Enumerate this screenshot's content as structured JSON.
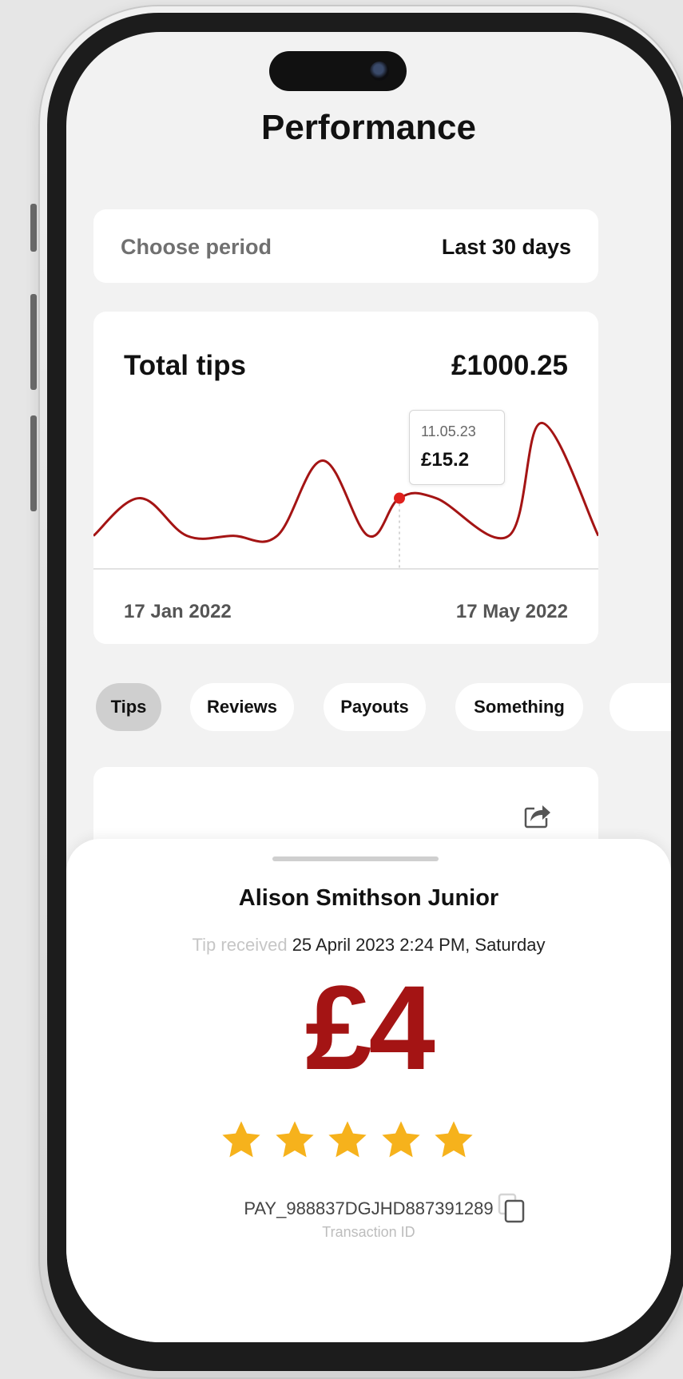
{
  "header": {
    "title": "Performance"
  },
  "period": {
    "label": "Choose period",
    "value": "Last 30 days"
  },
  "chart_data": {
    "type": "line",
    "title": "Total tips",
    "total": "£1000.25",
    "x_start_label": "17 Jan 2022",
    "x_end_label": "17 May 2022",
    "series_color": "#a41414",
    "highlight_color": "#e0201c",
    "y": [
      1.0,
      6.0,
      1.0,
      1.0,
      1.0,
      11.0,
      1.0,
      6.0,
      6.0,
      1.0,
      16.0,
      1.0
    ],
    "highlight_index": 7,
    "tooltip": {
      "date": "11.05.23",
      "value": "£15.2"
    },
    "grid": false
  },
  "tabs": [
    {
      "label": "Tips",
      "active": true
    },
    {
      "label": "Reviews",
      "active": false
    },
    {
      "label": "Payouts",
      "active": false
    },
    {
      "label": "Something",
      "active": false
    }
  ],
  "icons": {
    "share": "share-icon",
    "copy": "copy-icon",
    "star": "star-icon"
  },
  "sheet": {
    "name": "Alison Smithson Junior",
    "received_prefix": "Tip received",
    "received_time": "25 April 2023 2:24 PM, Saturday",
    "amount": "£4",
    "rating": 5,
    "rating_max": 5,
    "transaction_id": "PAY_988837DGJHD887391289",
    "transaction_label": "Transaction ID"
  },
  "colors": {
    "accent": "#a41414",
    "star": "#f6b21c",
    "background": "#f2f2f2"
  }
}
